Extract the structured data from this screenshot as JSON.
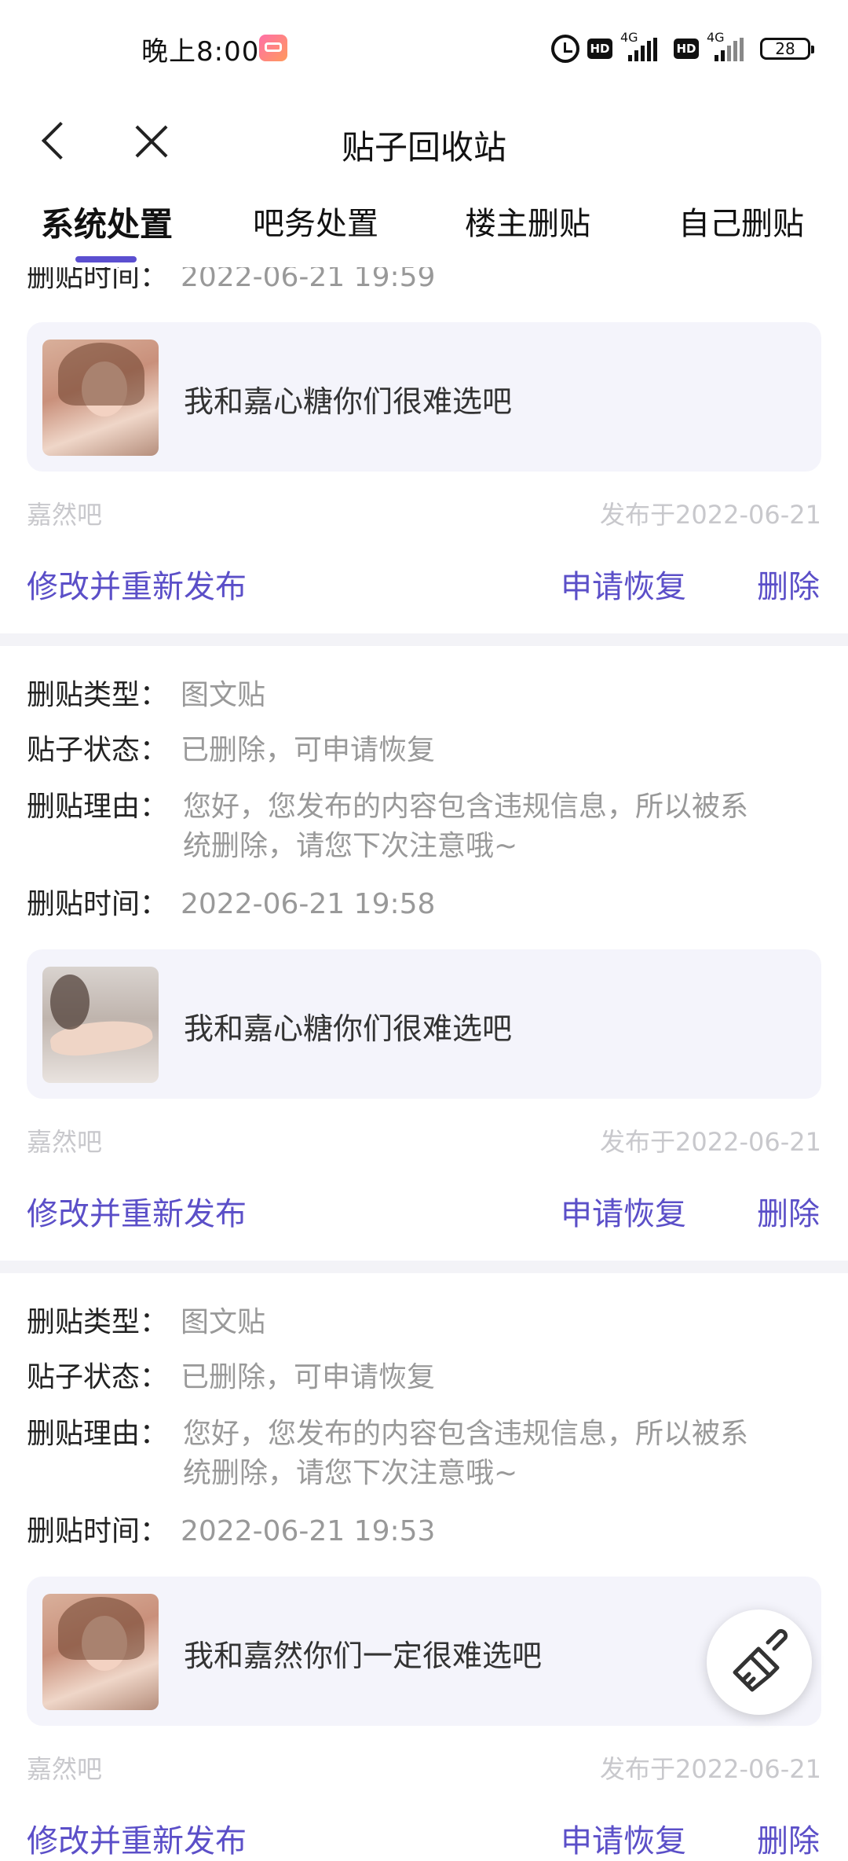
{
  "status_bar": {
    "time": "晚上8:00",
    "network_label": "4G",
    "hd_label": "HD",
    "battery": "28"
  },
  "header": {
    "title": "贴子回收站"
  },
  "tabs": [
    {
      "label": "系统处置",
      "active": true
    },
    {
      "label": "吧务处置",
      "active": false
    },
    {
      "label": "楼主删贴",
      "active": false
    },
    {
      "label": "自己删贴",
      "active": false
    }
  ],
  "labels": {
    "type_key": "删贴类型：",
    "status_key": "贴子状态：",
    "reason_key": "删贴理由：",
    "time_key": "删贴时间："
  },
  "actions": {
    "edit_republish": "修改并重新发布",
    "request_restore": "申请恢复",
    "delete": "删除"
  },
  "items": [
    {
      "delete_time": "2022-06-21 19:59",
      "post_text": "我和嘉心糖你们很难选吧",
      "forum": "嘉然吧",
      "published": "发布于2022-06-21"
    },
    {
      "delete_type": "图文贴",
      "status": "已删除，可申请恢复",
      "reason_line1": "您好，您发布的内容包含违规信息，所以被系",
      "reason_line2": "统删除，请您下次注意哦~",
      "delete_time": "2022-06-21 19:58",
      "post_text": "我和嘉心糖你们很难选吧",
      "forum": "嘉然吧",
      "published": "发布于2022-06-21"
    },
    {
      "delete_type": "图文贴",
      "status": "已删除，可申请恢复",
      "reason_line1": "您好，您发布的内容包含违规信息，所以被系",
      "reason_line2": "统删除，请您下次注意哦~",
      "delete_time": "2022-06-21 19:53",
      "post_text": "我和嘉然你们一定很难选吧",
      "forum": "嘉然吧",
      "published": "发布于2022-06-21"
    }
  ],
  "icons": [
    "alarm-icon",
    "signal-icon",
    "battery-icon",
    "back-icon",
    "close-icon",
    "broom-icon"
  ],
  "colors": {
    "accent": "#5b4fc8",
    "card_bg": "#f4f4fb",
    "muted_text": "#999999"
  }
}
